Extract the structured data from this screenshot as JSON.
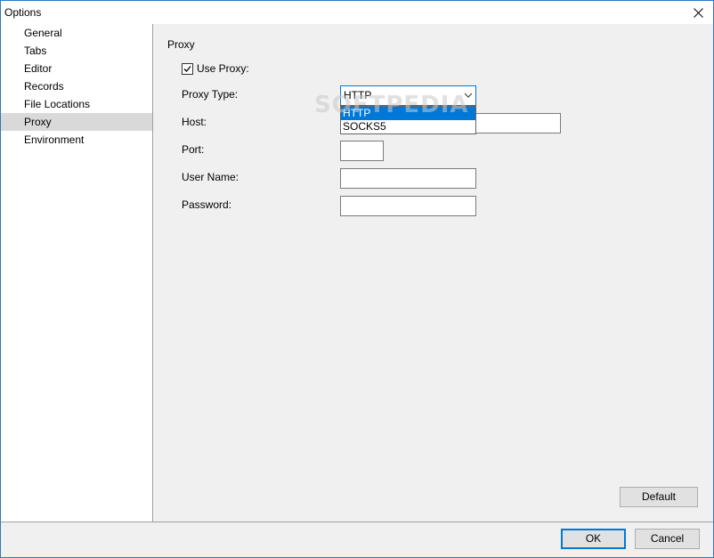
{
  "window": {
    "title": "Options",
    "close_icon": "close-icon"
  },
  "sidebar": {
    "items": [
      {
        "label": "General",
        "selected": false
      },
      {
        "label": "Tabs",
        "selected": false
      },
      {
        "label": "Editor",
        "selected": false
      },
      {
        "label": "Records",
        "selected": false
      },
      {
        "label": "File Locations",
        "selected": false
      },
      {
        "label": "Proxy",
        "selected": true
      },
      {
        "label": "Environment",
        "selected": false
      }
    ]
  },
  "proxy": {
    "section_title": "Proxy",
    "use_proxy": {
      "label": "Use Proxy:",
      "checked": true
    },
    "proxy_type": {
      "label": "Proxy Type:",
      "selected": "HTTP",
      "options": [
        "HTTP",
        "SOCKS5"
      ],
      "highlighted_option": "HTTP"
    },
    "host": {
      "label": "Host:",
      "value": ""
    },
    "port": {
      "label": "Port:",
      "value": ""
    },
    "user_name": {
      "label": "User Name:",
      "value": ""
    },
    "password": {
      "label": "Password:",
      "value": ""
    },
    "default_label": "Default"
  },
  "footer": {
    "ok_label": "OK",
    "cancel_label": "Cancel"
  },
  "watermark": "SOFTPEDIA",
  "colors": {
    "accent": "#0078d7",
    "selection": "#d9d9d9",
    "frame": "#2b78c5"
  }
}
